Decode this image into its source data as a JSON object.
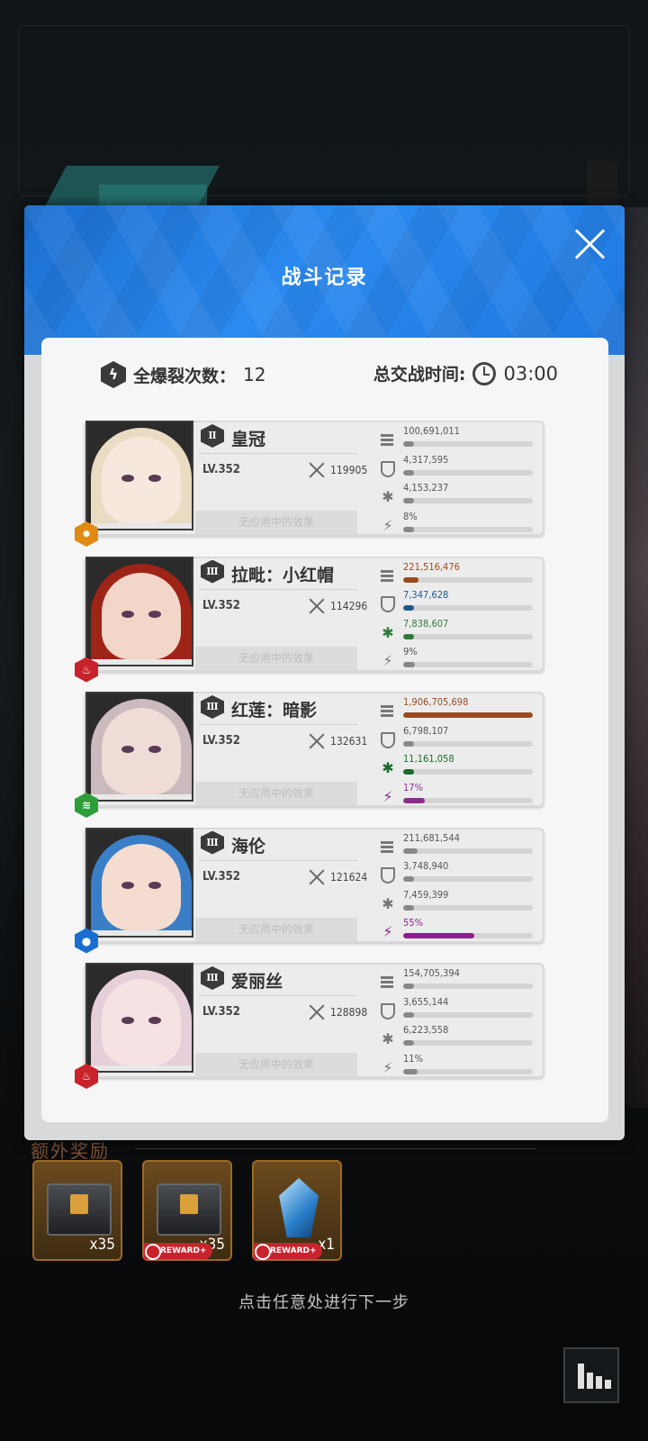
{
  "modal": {
    "title": "战斗记录",
    "close_icon": "close-icon",
    "summary": {
      "burst_label": "全爆裂次数：",
      "burst_count": "12",
      "burst_icon": "lightning-hex-icon",
      "battle_time_label": "总交战时间:",
      "battle_time": "03:00",
      "clock_icon": "clock-icon"
    },
    "units": [
      {
        "rank": "Ⅱ",
        "name": "皇冠",
        "level": "LV.352",
        "power": "119905",
        "effect": "无应用中的效果",
        "element": "iron",
        "element_color": "#e08a12",
        "stats": {
          "damage": "100,691,011",
          "shield": "4,317,595",
          "heal": "4,153,237",
          "burst": "8%"
        },
        "fills": {
          "damage": 0.05,
          "shield": 0.0,
          "heal": 0.0,
          "burst": 0.08
        },
        "colors": {
          "damage": "#888888",
          "shield": "#888888",
          "heal": "#888888",
          "burst": "#888888"
        },
        "portrait": {
          "hair": "#e9dcc2",
          "face": "#f6e8dc"
        }
      },
      {
        "rank": "Ⅲ",
        "name": "拉毗：小红帽",
        "level": "LV.352",
        "power": "114296",
        "effect": "无应用中的效果",
        "element": "fire",
        "element_color": "#c8232c",
        "stats": {
          "damage": "221,516,476",
          "shield": "7,347,628",
          "heal": "7,838,607",
          "burst": "9%"
        },
        "fills": {
          "damage": 0.12,
          "shield": 0.0,
          "heal": 0.0,
          "burst": 0.09
        },
        "colors": {
          "damage": "#9a4a20",
          "shield": "#1f5a8a",
          "heal": "#2f7a3a",
          "burst": "#888888"
        },
        "portrait": {
          "hair": "#9e2418",
          "face": "#f2d6c8"
        }
      },
      {
        "rank": "Ⅲ",
        "name": "红莲：暗影",
        "level": "LV.352",
        "power": "132631",
        "effect": "无应用中的效果",
        "element": "wind",
        "element_color": "#2e9e3a",
        "stats": {
          "damage": "1,906,705,698",
          "shield": "6,798,107",
          "heal": "11,161,058",
          "burst": "17%"
        },
        "fills": {
          "damage": 1.0,
          "shield": 0.0,
          "heal": 0.0,
          "burst": 0.17
        },
        "colors": {
          "damage": "#9a4a20",
          "shield": "#888888",
          "heal": "#1e6a2a",
          "burst": "#8a2e8a"
        },
        "portrait": {
          "hair": "#cbbabd",
          "face": "#efdcd6"
        }
      },
      {
        "rank": "Ⅲ",
        "name": "海伦",
        "level": "LV.352",
        "power": "121624",
        "effect": "无应用中的效果",
        "element": "water",
        "element_color": "#1a6ed0",
        "stats": {
          "damage": "211,681,544",
          "shield": "3,748,940",
          "heal": "7,459,399",
          "burst": "55%"
        },
        "fills": {
          "damage": 0.11,
          "shield": 0.0,
          "heal": 0.0,
          "burst": 0.55
        },
        "colors": {
          "damage": "#888888",
          "shield": "#888888",
          "heal": "#888888",
          "burst": "#8a1f8a"
        },
        "portrait": {
          "hair": "#3a7ec8",
          "face": "#f4ddd0"
        }
      },
      {
        "rank": "Ⅲ",
        "name": "爱丽丝",
        "level": "LV.352",
        "power": "128898",
        "effect": "无应用中的效果",
        "element": "fire",
        "element_color": "#c8232c",
        "stats": {
          "damage": "154,705,394",
          "shield": "3,655,144",
          "heal": "6,223,558",
          "burst": "11%"
        },
        "fills": {
          "damage": 0.08,
          "shield": 0.0,
          "heal": 0.0,
          "burst": 0.11
        },
        "colors": {
          "damage": "#888888",
          "shield": "#888888",
          "heal": "#888888",
          "burst": "#888888"
        },
        "portrait": {
          "hair": "#e6cfd8",
          "face": "#f6e2e2"
        }
      }
    ]
  },
  "rewards": {
    "title": "额外奖励",
    "items": [
      {
        "type": "crate",
        "count": "x35",
        "tag": ""
      },
      {
        "type": "crate",
        "count": "x35",
        "tag": "REWARD+"
      },
      {
        "type": "gem",
        "count": "x1",
        "tag": "REWARD+"
      }
    ]
  },
  "footer": {
    "hint": "点击任意处进行下一步",
    "stats_icon": "bar-chart-icon"
  }
}
